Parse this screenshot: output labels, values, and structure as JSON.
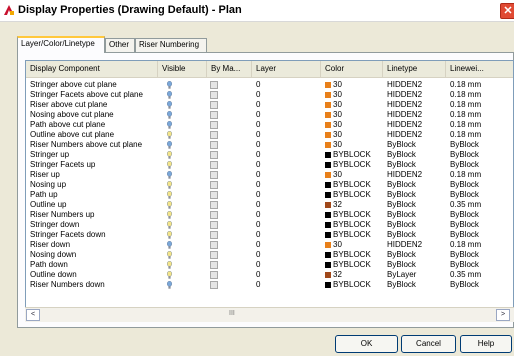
{
  "window": {
    "title": "Display Properties (Drawing Default) - Plan",
    "close_label": "✕"
  },
  "tabs": [
    {
      "label": "Layer/Color/Linetype"
    },
    {
      "label": "Other"
    },
    {
      "label": "Riser Numbering"
    }
  ],
  "table": {
    "headers": [
      "Display Component",
      "Visible",
      "By Ma...",
      "Layer",
      "Color",
      "Linetype",
      "Linewei..."
    ],
    "rows": [
      {
        "component": "Stringer above cut plane",
        "visible": true,
        "by_material": false,
        "layer": "0",
        "color": "30",
        "color_hex": "#e8801a",
        "linetype": "HIDDEN2",
        "lineweight": "0.18 mm"
      },
      {
        "component": "Stringer Facets above cut plane",
        "visible": true,
        "by_material": false,
        "layer": "0",
        "color": "30",
        "color_hex": "#e8801a",
        "linetype": "HIDDEN2",
        "lineweight": "0.18 mm"
      },
      {
        "component": "Riser above cut plane",
        "visible": true,
        "by_material": false,
        "layer": "0",
        "color": "30",
        "color_hex": "#e8801a",
        "linetype": "HIDDEN2",
        "lineweight": "0.18 mm"
      },
      {
        "component": "Nosing above cut plane",
        "visible": true,
        "by_material": false,
        "layer": "0",
        "color": "30",
        "color_hex": "#e8801a",
        "linetype": "HIDDEN2",
        "lineweight": "0.18 mm"
      },
      {
        "component": "Path above cut plane",
        "visible": true,
        "by_material": false,
        "layer": "0",
        "color": "30",
        "color_hex": "#e8801a",
        "linetype": "HIDDEN2",
        "lineweight": "0.18 mm"
      },
      {
        "component": "Outline above cut plane",
        "visible": false,
        "by_material": false,
        "layer": "0",
        "color": "30",
        "color_hex": "#e8801a",
        "linetype": "HIDDEN2",
        "lineweight": "0.18 mm"
      },
      {
        "component": "Riser Numbers above cut plane",
        "visible": true,
        "by_material": false,
        "layer": "0",
        "color": "30",
        "color_hex": "#e8801a",
        "linetype": "ByBlock",
        "lineweight": "ByBlock"
      },
      {
        "component": "Stringer up",
        "visible": false,
        "by_material": false,
        "layer": "0",
        "color": "BYBLOCK",
        "color_hex": "#000000",
        "linetype": "ByBlock",
        "lineweight": "ByBlock"
      },
      {
        "component": "Stringer Facets up",
        "visible": false,
        "by_material": false,
        "layer": "0",
        "color": "BYBLOCK",
        "color_hex": "#000000",
        "linetype": "ByBlock",
        "lineweight": "ByBlock"
      },
      {
        "component": "Riser up",
        "visible": true,
        "by_material": false,
        "layer": "0",
        "color": "30",
        "color_hex": "#e8801a",
        "linetype": "HIDDEN2",
        "lineweight": "0.18 mm"
      },
      {
        "component": "Nosing up",
        "visible": false,
        "by_material": false,
        "layer": "0",
        "color": "BYBLOCK",
        "color_hex": "#000000",
        "linetype": "ByBlock",
        "lineweight": "ByBlock"
      },
      {
        "component": "Path up",
        "visible": false,
        "by_material": false,
        "layer": "0",
        "color": "BYBLOCK",
        "color_hex": "#000000",
        "linetype": "ByBlock",
        "lineweight": "ByBlock"
      },
      {
        "component": "Outline up",
        "visible": false,
        "by_material": false,
        "layer": "0",
        "color": "32",
        "color_hex": "#a0481a",
        "linetype": "ByBlock",
        "lineweight": "0.35 mm"
      },
      {
        "component": "Riser Numbers up",
        "visible": false,
        "by_material": false,
        "layer": "0",
        "color": "BYBLOCK",
        "color_hex": "#000000",
        "linetype": "ByBlock",
        "lineweight": "ByBlock"
      },
      {
        "component": "Stringer down",
        "visible": false,
        "by_material": false,
        "layer": "0",
        "color": "BYBLOCK",
        "color_hex": "#000000",
        "linetype": "ByBlock",
        "lineweight": "ByBlock"
      },
      {
        "component": "Stringer Facets down",
        "visible": false,
        "by_material": false,
        "layer": "0",
        "color": "BYBLOCK",
        "color_hex": "#000000",
        "linetype": "ByBlock",
        "lineweight": "ByBlock"
      },
      {
        "component": "Riser down",
        "visible": true,
        "by_material": false,
        "layer": "0",
        "color": "30",
        "color_hex": "#e8801a",
        "linetype": "HIDDEN2",
        "lineweight": "0.18 mm"
      },
      {
        "component": "Nosing down",
        "visible": false,
        "by_material": false,
        "layer": "0",
        "color": "BYBLOCK",
        "color_hex": "#000000",
        "linetype": "ByBlock",
        "lineweight": "ByBlock"
      },
      {
        "component": "Path down",
        "visible": false,
        "by_material": false,
        "layer": "0",
        "color": "BYBLOCK",
        "color_hex": "#000000",
        "linetype": "ByBlock",
        "lineweight": "ByBlock"
      },
      {
        "component": "Outline down",
        "visible": false,
        "by_material": false,
        "layer": "0",
        "color": "32",
        "color_hex": "#a0481a",
        "linetype": "ByLayer",
        "lineweight": "0.35 mm"
      },
      {
        "component": "Riser Numbers down",
        "visible": true,
        "by_material": false,
        "layer": "0",
        "color": "BYBLOCK",
        "color_hex": "#000000",
        "linetype": "ByBlock",
        "lineweight": "ByBlock"
      }
    ]
  },
  "scrollbar": {
    "left_arrow": "<",
    "right_arrow": ">",
    "grip": "III"
  },
  "buttons": {
    "ok": "OK",
    "cancel": "Cancel",
    "help": "Help"
  },
  "colors": {
    "bulb_on": "#7aa7d9",
    "bulb_off": "#f3e48a"
  }
}
